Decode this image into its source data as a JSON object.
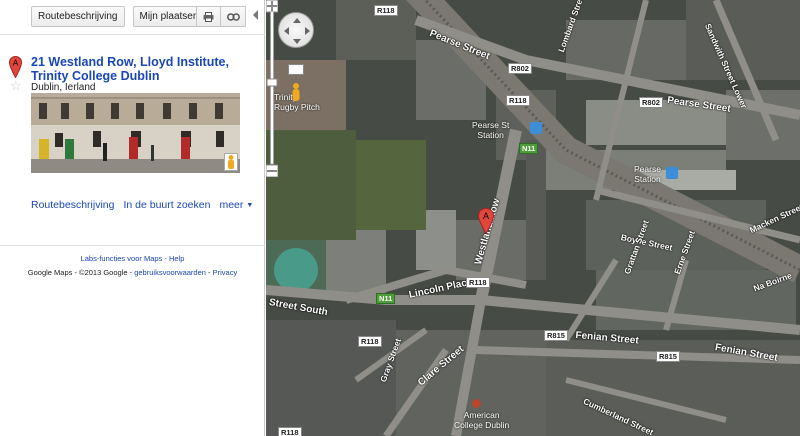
{
  "toolbar": {
    "directions_label": "Routebeschrijving",
    "my_places_label": "Mijn plaatsen"
  },
  "place": {
    "marker_letter": "A",
    "title": "21 Westland Row, Lloyd Institute, Trinity College Dublin",
    "subtitle": "Dublin, Ierland"
  },
  "actions": {
    "directions": "Routebeschrijving",
    "nearby": "In de buurt zoeken",
    "more": "meer"
  },
  "footer": {
    "labs": "Labs-functies voor Maps",
    "help": "Help",
    "copyright": "Google Maps - ©2013 Google -",
    "terms": "gebruiksvoorwaarden",
    "privacy": "Privacy"
  },
  "map": {
    "streets": {
      "pearse_top": "Pearse Street",
      "pearse_right": "Pearse Street",
      "westland_row": "Westland Row",
      "lincoln_place": "Lincoln Place",
      "south": "Street South",
      "fenian_1": "Fenian Street",
      "fenian_2": "Fenian Street",
      "clare": "Clare Street",
      "boyne": "Boyne Street",
      "cumberland": "Cumberland Street",
      "sandwith": "Sandwith Street Lower",
      "erne": "Erne Street",
      "macken": "Macken Street",
      "grattan": "Grattan Street",
      "lombard": "Lombard Street",
      "na_boirne": "Na Boirne",
      "gray": "Gray Street"
    },
    "shields": {
      "r118_top": "R118",
      "r802_a": "R802",
      "r118_b": "R118",
      "r802_b": "R802",
      "n11_a": "N11",
      "r118_c": "R118",
      "n11_b": "N11",
      "r118_d": "R118",
      "r815_a": "R815",
      "r815_b": "R815",
      "r118_e": "R118"
    },
    "pois": {
      "pearse_st_station": "Pearse St\nStation",
      "pearse_station": "Pearse\nStation",
      "rugby_pitch": "Trinity\nRugby Pitch",
      "american_college": "American\nCollege Dublin"
    },
    "marker_letter": "A",
    "colors": {
      "link": "#1a47b8",
      "marker": "#e0463c",
      "green_shield": "#4f9d3a"
    }
  }
}
